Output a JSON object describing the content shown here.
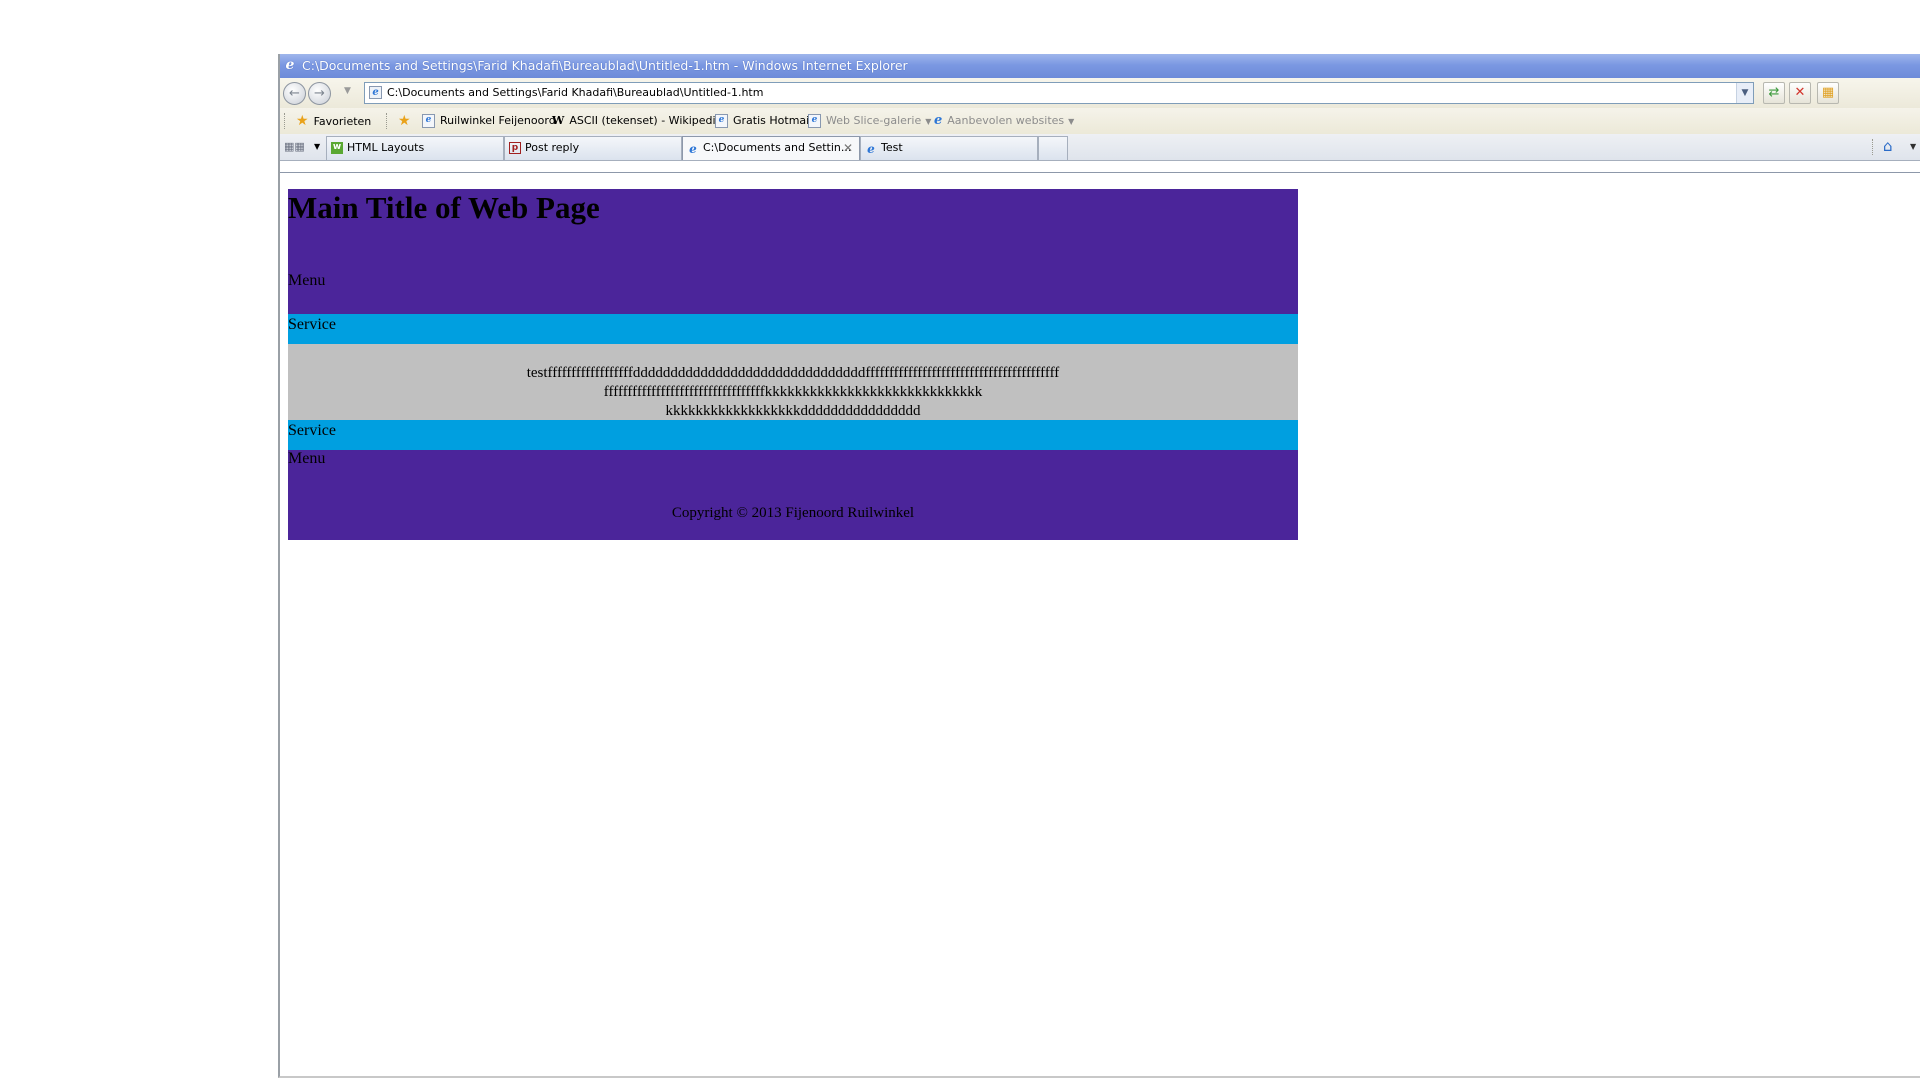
{
  "window": {
    "title": "C:\\Documents and Settings\\Farid Khadafi\\Bureaublad\\Untitled-1.htm - Windows Internet Explorer"
  },
  "addressbar": {
    "url": "C:\\Documents and Settings\\Farid Khadafi\\Bureaublad\\Untitled-1.htm"
  },
  "favorites": {
    "label": "Favorieten",
    "items": [
      {
        "label": "Ruilwinkel Feijenoord",
        "icon": "ie-page-icon"
      },
      {
        "label": "ASCII (tekenset) - Wikipedia",
        "icon": "wikipedia-icon"
      },
      {
        "label": "Gratis Hotmail",
        "icon": "ie-page-icon"
      },
      {
        "label": "Web Slice-galerie",
        "icon": "ie-page-icon",
        "disabled": true
      },
      {
        "label": "Aanbevolen websites",
        "icon": "ie-logo-icon",
        "disabled": true
      }
    ]
  },
  "tabs": [
    {
      "label": "HTML Layouts",
      "icon": "w3schools-icon"
    },
    {
      "label": "Post reply",
      "icon": "forum-icon"
    },
    {
      "label": "C:\\Documents and Settin...",
      "icon": "ie-logo-icon",
      "active": true
    },
    {
      "label": "Test",
      "icon": "ie-logo-icon"
    }
  ],
  "page": {
    "title": "Main Title of Web Page",
    "menu_top": "Menu",
    "service_top": "Service",
    "content_lines": [
      "testffffffffffffffffffdddddddddddddddddddddddddddddddfffffffffffffffffffffffffffffffffffffffff",
      "ffffffffffffffffffffffffffffffffffkkkkkkkkkkkkkkkkkkkkkkkkkkkkk",
      "kkkkkkkkkkkkkkkkkkdddddddddddddddd"
    ],
    "service_bottom": "Service",
    "menu_bottom": "Menu",
    "copyright": "Copyright © 2013 Fijenoord Ruilwinkel"
  },
  "colors": {
    "header_purple": "#4b259a",
    "service_blue": "#009fe0",
    "content_gray": "#c0c0c0"
  }
}
